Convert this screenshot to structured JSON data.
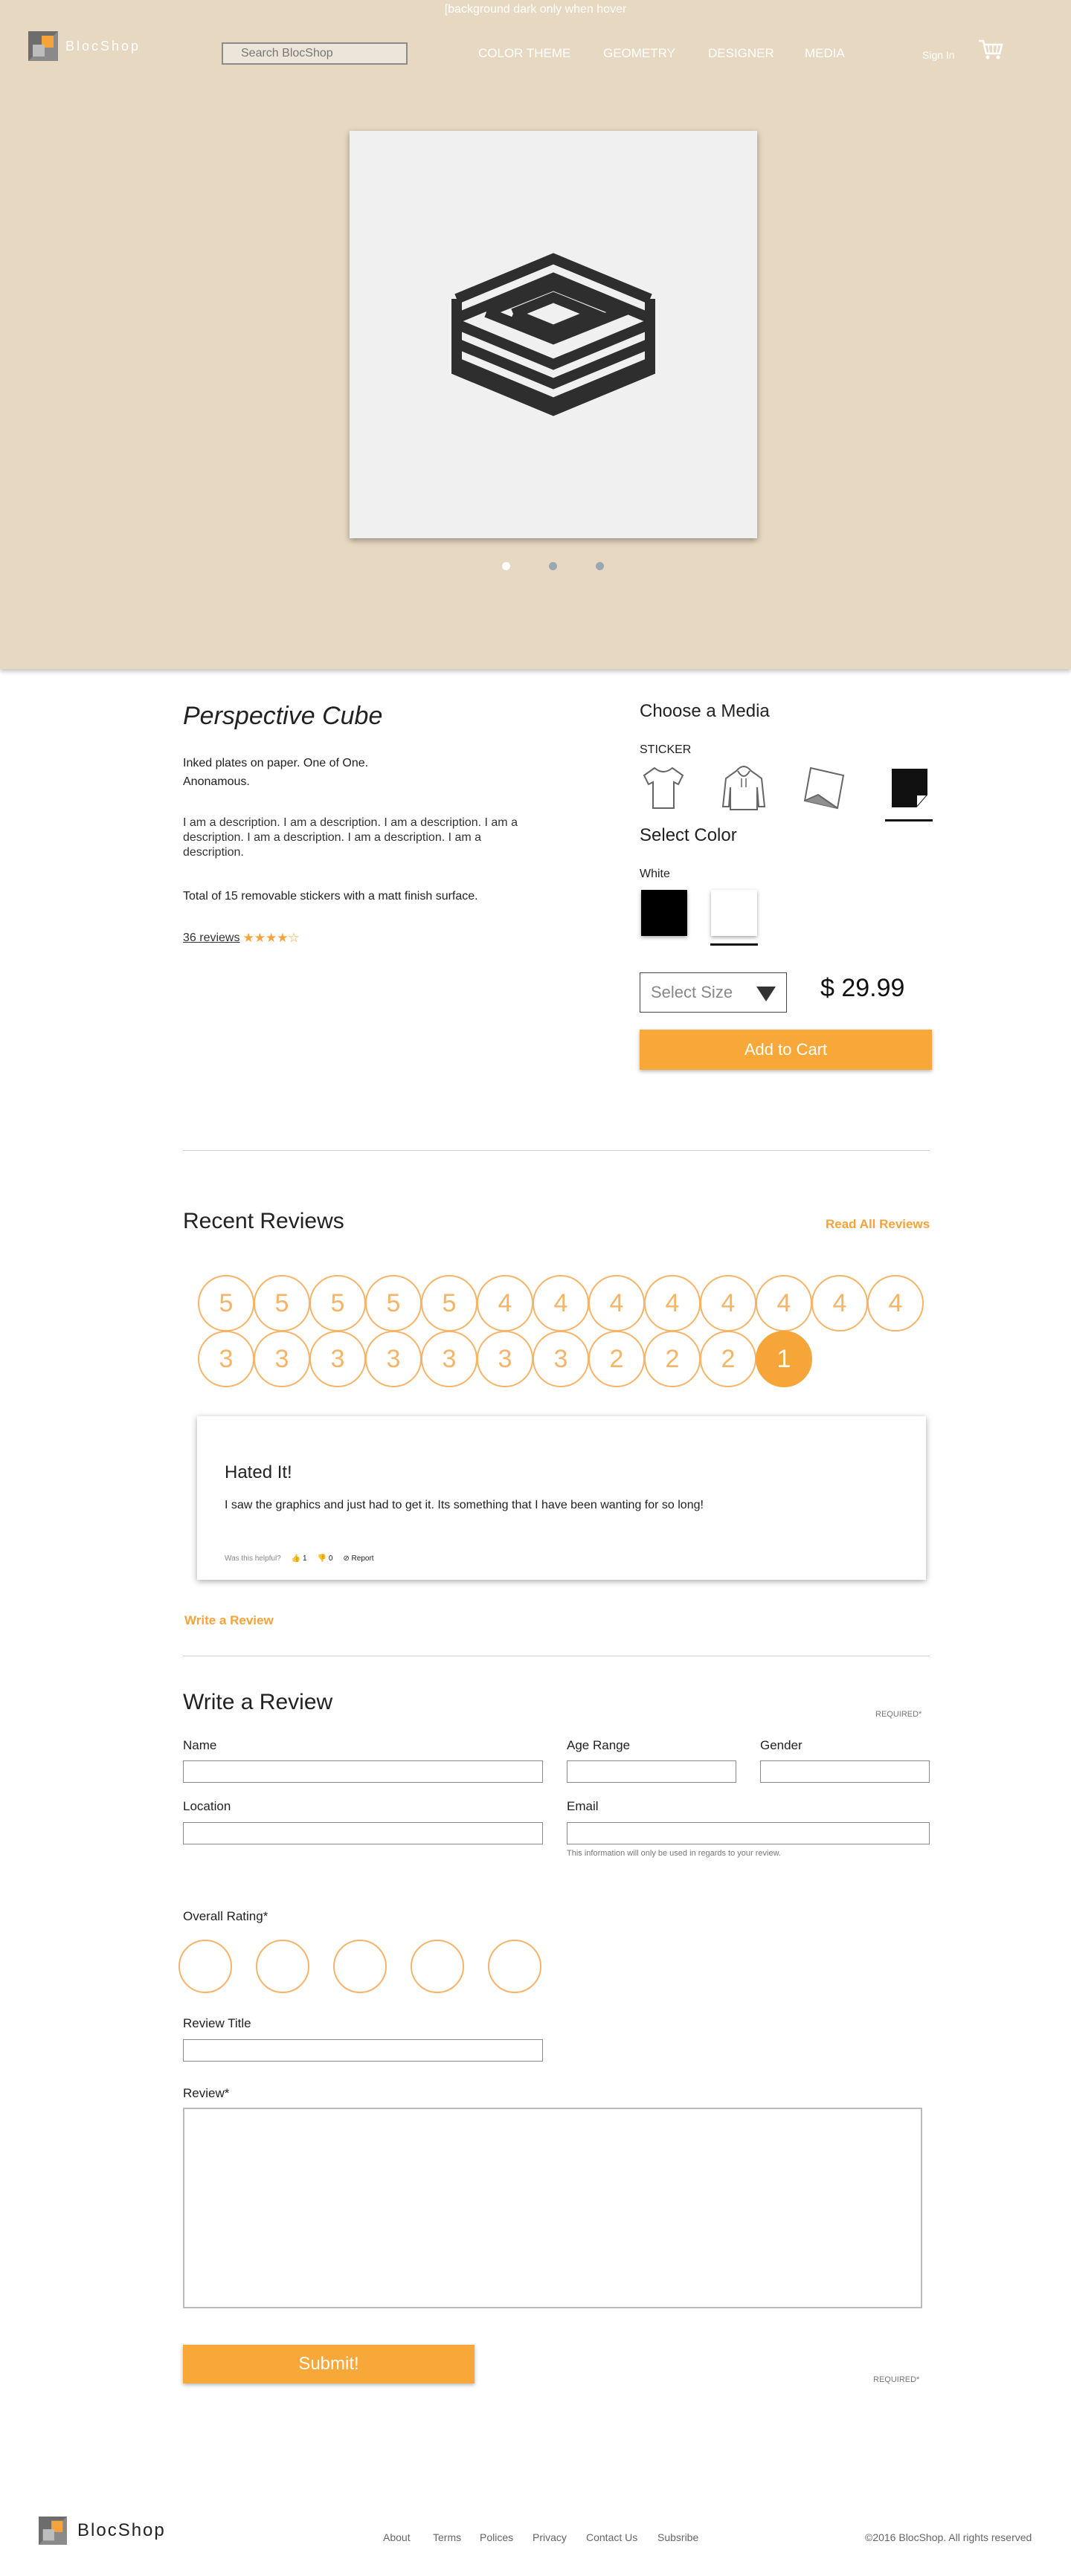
{
  "hero": {
    "hover_note": "[background dark only when hover",
    "bg_color": "#e6d8c1"
  },
  "header": {
    "logo_text": "BlocShop",
    "search_placeholder": "Search BlocShop",
    "nav": [
      "COLOR THEME",
      "GEOMETRY",
      "DESIGNER",
      "MEDIA"
    ],
    "signin": "Sign In",
    "cart_icon": "cart-icon"
  },
  "product": {
    "title": "Perspective Cube",
    "line1": "Inked plates on paper. One of One.",
    "line2": "Anonamous.",
    "description": "I am a description. I am a description. I am a description. I am a description. I am a description. I am a description. I am a description.",
    "stickers_note": "Total of 15 removable stickers with a matt finish surface.",
    "reviews_link": "36 reviews",
    "rating_stars": 4,
    "carousel_dots": 3,
    "carousel_active": 0
  },
  "options": {
    "choose_media": "Choose a Media",
    "media_selected": "STICKER",
    "media_icons": [
      "tshirt-icon",
      "hoodie-icon",
      "print-paper-icon",
      "sticker-icon"
    ],
    "select_color": "Select Color",
    "color_selected": "White",
    "colors": [
      "#000000",
      "#ffffff"
    ],
    "size_placeholder": "Select Size",
    "price": "$ 29.99",
    "add_to_cart": "Add to Cart",
    "accent_color": "#f7a838"
  },
  "reviews": {
    "title": "Recent Reviews",
    "read_all": "Read All Reviews",
    "ratings": [
      "5",
      "5",
      "5",
      "5",
      "5",
      "4",
      "4",
      "4",
      "4",
      "4",
      "4",
      "4",
      "4",
      "3",
      "3",
      "3",
      "3",
      "3",
      "3",
      "3",
      "2",
      "2",
      "2",
      "1"
    ],
    "selected": "1",
    "card": {
      "title": "Hated It!",
      "body": "I saw the graphics and just had to get it. Its something that I have been wanting for so long!",
      "helpful": "Was this helpful?",
      "up_count": "1",
      "down_count": "0",
      "report": "Report"
    },
    "write_link": "Write a Review"
  },
  "form": {
    "title": "Write a Review",
    "required": "REQUIRED*",
    "name": "Name",
    "age_range": "Age Range",
    "gender": "Gender",
    "location": "Location",
    "email": "Email",
    "email_note": "This information will only be used in regards to your review.",
    "overall_rating": "Overall Rating*",
    "rating_options": 5,
    "review_title": "Review Title",
    "review": "Review*",
    "submit": "Submit!",
    "required_bottom": "REQUIRED*"
  },
  "footer": {
    "logo_text": "BlocShop",
    "links": [
      "About",
      "Terms",
      "Polices",
      "Privacy",
      "Contact Us",
      "Subsribe"
    ],
    "copyright": "©2016 BlocShop. All rights reserved"
  }
}
